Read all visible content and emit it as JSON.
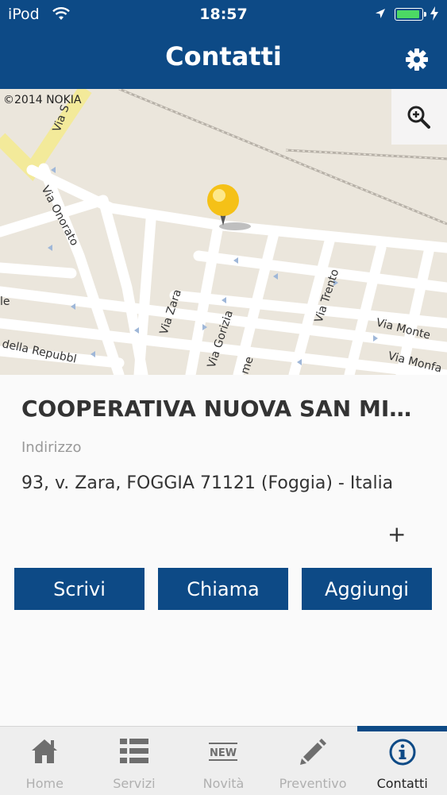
{
  "status_bar": {
    "carrier": "iPod",
    "time": "18:57",
    "battery_level": 0.95
  },
  "header": {
    "title": "Contatti"
  },
  "map": {
    "copyright": "©2014 NOKIA",
    "streets": {
      "via_onorato": "Via Onorato",
      "via_zara": "Via Zara",
      "via_gorizia": "Via Gorizia",
      "via_trento": "Via Trento",
      "via_montegrappa": "Via Monte",
      "via_monfalcone": "Via Monfa",
      "via_repubblica": "della Repubbl",
      "via_partial_top": "Via S",
      "le_partial": "le",
      "me_partial": "me"
    }
  },
  "contact": {
    "name": "COOPERATIVA NUOVA SAN MI…",
    "address_label": "Indirizzo",
    "address": "93, v. Zara, FOGGIA 71121 (Foggia) - Italia",
    "more_symbol": "+"
  },
  "actions": {
    "write": "Scrivi",
    "call": "Chiama",
    "add": "Aggiungi"
  },
  "tabs": [
    {
      "label": "Home"
    },
    {
      "label": "Servizi"
    },
    {
      "label": "Novità",
      "icon_text": "NEW"
    },
    {
      "label": "Preventivo"
    },
    {
      "label": "Contatti",
      "active": true
    }
  ]
}
